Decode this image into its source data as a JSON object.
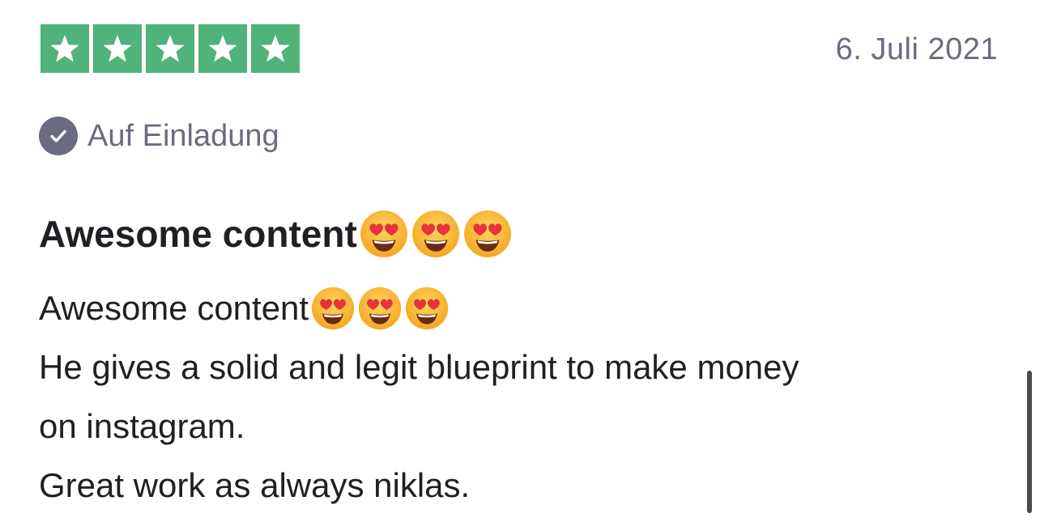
{
  "review": {
    "rating": 5,
    "rating_max": 5,
    "star_color": "#4fb37a",
    "date": "6. Juli 2021",
    "verified_label": "Auf Einladung",
    "title_text": "Awesome content",
    "title_emoji": "heart-eyes-icon",
    "title_emoji_count": 3,
    "body": {
      "line1_text": "Awesome content",
      "line1_emoji_count": 3,
      "line2": "He gives a solid and legit blueprint to make money",
      "line3": "on instagram.",
      "line4": "Great work as always niklas."
    }
  }
}
